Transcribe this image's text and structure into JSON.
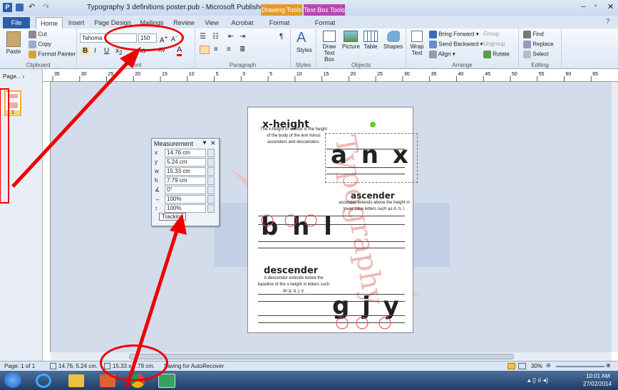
{
  "window": {
    "title": "Typography 3 definitions poster.pub - Microsoft Publisher",
    "context_drawing": "Drawing Tools",
    "context_textbox": "Text Box Tools"
  },
  "tabs": [
    "File",
    "Home",
    "Insert",
    "Page Design",
    "Mailings",
    "Review",
    "View",
    "Acrobat",
    "Format",
    "Format"
  ],
  "ribbon": {
    "clipboard": {
      "paste": "Paste",
      "cut": "Cut",
      "copy": "Copy",
      "format_painter": "Format Painter",
      "label": "Clipboard"
    },
    "font": {
      "family": "Tahoma",
      "size": "150",
      "label": "Font"
    },
    "paragraph": {
      "label": "Paragraph"
    },
    "styles": {
      "label": "Styles",
      "button": "Styles"
    },
    "objects": {
      "draw_text_box": "Draw Text Box",
      "picture": "Picture",
      "table": "Table",
      "shapes": "Shapes",
      "label": "Objects"
    },
    "arrange": {
      "wrap_text": "Wrap Text",
      "bring_forward": "Bring Forward",
      "send_backward": "Send Backward",
      "align": "Align",
      "group": "Group",
      "ungroup": "Ungroup",
      "rotate": "Rotate",
      "label": "Arrange"
    },
    "editing": {
      "find": "Find",
      "replace": "Replace",
      "select": "Select",
      "label": "Editing"
    }
  },
  "page_pane": {
    "label": "Page...",
    "thumb_number": "1"
  },
  "ruler_ticks": [
    "35",
    "30",
    "25",
    "20",
    "15",
    "10",
    "5",
    "0",
    "5",
    "10",
    "15",
    "20",
    "25",
    "30",
    "35",
    "40",
    "45",
    "50",
    "55",
    "60",
    "65"
  ],
  "poster": {
    "xheight_title": "x-height",
    "xheight_desc": "The x-height of a letter is the height of the body of the text minus ascenders and descenders.",
    "xheight_letters": "a n x",
    "ascender_title": "ascender",
    "ascender_desc": "ascender extends above the height in lower case letters such as d, h, l.",
    "ascender_letters": "b h l",
    "descender_title": "descender",
    "descender_desc": "A descender extends below the baseline of the x-height in letters such as g, q, j, y.",
    "descender_letters": "g j y",
    "vertical_word": "Typography"
  },
  "measurement": {
    "title": "Measurement",
    "rows": [
      {
        "label": "x",
        "value": "14.76 cm"
      },
      {
        "label": "y",
        "value": "5.24 cm"
      },
      {
        "label": "w",
        "value": "15.33 cm"
      },
      {
        "label": "h",
        "value": "7.79 cm"
      },
      {
        "label": "∡",
        "value": "0°"
      },
      {
        "label": "↔",
        "value": "100%"
      },
      {
        "label": "↕",
        "value": "100%"
      }
    ],
    "tooltip": "Tracking"
  },
  "status": {
    "page": "Page: 1 of 1",
    "position": "14.76, 5.24 cm.",
    "size": "15.33 x 7.79 cm.",
    "autosave": "Saving for AutoRecover",
    "zoom": "30%"
  },
  "clock": {
    "time": "10:01 AM",
    "date": "27/02/2014"
  }
}
